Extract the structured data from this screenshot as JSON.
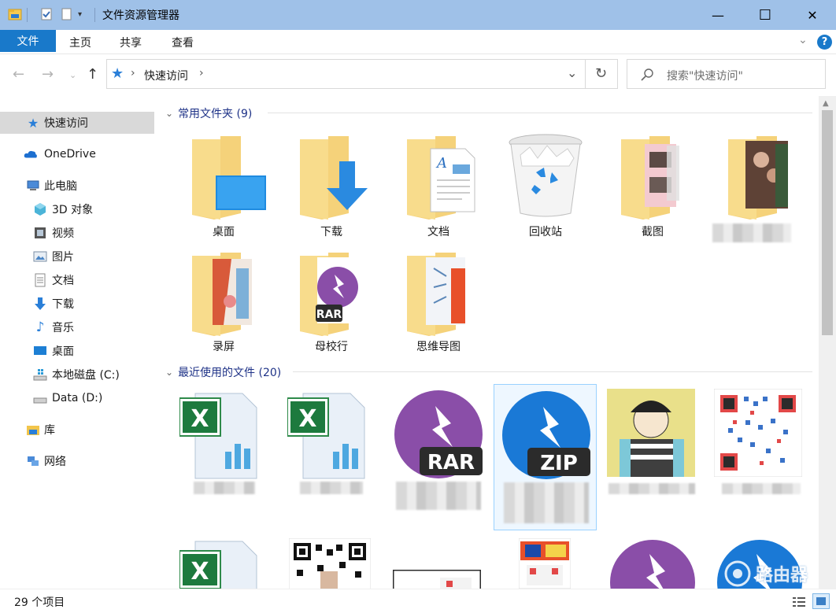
{
  "window": {
    "title": "文件资源管理器",
    "buttons": {
      "minimize": "—",
      "maximize": "☐",
      "close": "✕"
    }
  },
  "ribbon": {
    "tabs": [
      "文件",
      "主页",
      "共享",
      "查看"
    ],
    "help": "?"
  },
  "addressbar": {
    "path": "快速访问",
    "search_placeholder": "搜索\"快速访问\""
  },
  "sidebar": {
    "items": [
      {
        "label": "快速访问",
        "icon": "star-icon",
        "active": true
      },
      {
        "label": "OneDrive",
        "icon": "cloud-icon"
      },
      {
        "label": "此电脑",
        "icon": "computer-icon"
      },
      {
        "label": "3D 对象",
        "icon": "cube-icon"
      },
      {
        "label": "视频",
        "icon": "film-icon"
      },
      {
        "label": "图片",
        "icon": "picture-icon"
      },
      {
        "label": "文档",
        "icon": "document-icon"
      },
      {
        "label": "下载",
        "icon": "download-icon"
      },
      {
        "label": "音乐",
        "icon": "music-icon"
      },
      {
        "label": "桌面",
        "icon": "desktop-icon"
      },
      {
        "label": "本地磁盘 (C:)",
        "icon": "windows-drive-icon"
      },
      {
        "label": "Data (D:)",
        "icon": "drive-icon"
      },
      {
        "label": "库",
        "icon": "library-icon"
      },
      {
        "label": "网络",
        "icon": "network-icon"
      }
    ]
  },
  "sections": {
    "frequent": {
      "title": "常用文件夹 (9)"
    },
    "recent": {
      "title": "最近使用的文件 (20)"
    }
  },
  "folders": [
    {
      "label": "桌面",
      "icon": "desktop-folder-icon"
    },
    {
      "label": "下载",
      "icon": "download-folder-icon"
    },
    {
      "label": "文档",
      "icon": "documents-folder-icon"
    },
    {
      "label": "回收站",
      "icon": "recycle-bin-icon"
    },
    {
      "label": "截图",
      "icon": "screenshot-folder-icon"
    },
    {
      "label": "",
      "icon": "photo-folder-icon"
    },
    {
      "label": "录屏",
      "icon": "recording-folder-icon"
    },
    {
      "label": "母校行",
      "icon": "rar-folder-icon"
    },
    {
      "label": "思维导图",
      "icon": "mindmap-folder-icon"
    }
  ],
  "recent_badges": {
    "rar": "RAR",
    "zip": "ZIP",
    "xls": "X"
  },
  "status": {
    "count": "29 个项目"
  },
  "watermark": "路由器"
}
